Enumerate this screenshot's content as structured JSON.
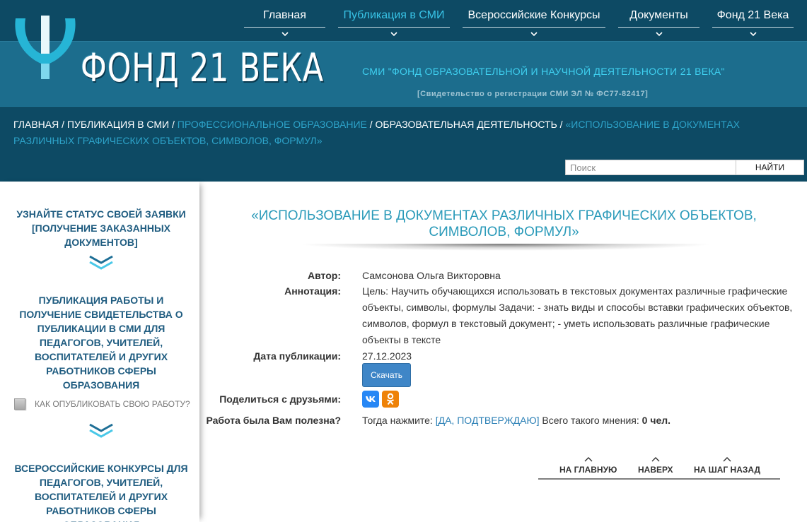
{
  "header": {
    "brand": "ФОНД 21 ВЕКА",
    "media_title": "СМИ \"ФОНД ОБРАЗОВАТЕЛЬНОЙ И НАУЧНОЙ ДЕЯТЕЛЬНОСТИ 21 ВЕКА\"",
    "media_cert": "[Свидетельство о регистрации СМИ ЭЛ № ФС77-82417]"
  },
  "nav": [
    {
      "label": "Главная",
      "active": false
    },
    {
      "label": "Публикация в СМИ",
      "active": true
    },
    {
      "label": "Всероссийские Конкурсы",
      "active": false
    },
    {
      "label": "Документы",
      "active": false
    },
    {
      "label": "Фонд 21 Века",
      "active": false
    }
  ],
  "breadcrumb": {
    "home": "ГЛАВНАЯ",
    "sep": " / ",
    "publication": "ПУБЛИКАЦИЯ В СМИ",
    "prof_edu": "ПРОФЕССИОНАЛЬНОЕ ОБРАЗОВАНИЕ",
    "edu_activity": "ОБРАЗОВАТЕЛЬНАЯ ДЕЯТЕЛЬНОСТЬ",
    "current": "«ИСПОЛЬЗОВАНИЕ В ДОКУМЕНТАХ РАЗЛИЧНЫХ ГРАФИЧЕСКИХ ОБЪЕКТОВ, СИМВОЛОВ, ФОРМУЛ»"
  },
  "search": {
    "placeholder": "Поиск",
    "button": "НАЙТИ"
  },
  "sidebar": {
    "status": "УЗНАЙТЕ СТАТУС СВОЕЙ ЗАЯВКИ [ПОЛУЧЕНИЕ ЗАКАЗАННЫХ ДОКУМЕНТОВ]",
    "publication": "ПУБЛИКАЦИЯ РАБОТЫ И ПОЛУЧЕНИЕ СВИДЕТЕЛЬСТВА О ПУБЛИКАЦИИ В СМИ ДЛЯ ПЕДАГОГОВ, УЧИТЕЛЕЙ, ВОСПИТАТЕЛЕЙ И ДРУГИХ РАБОТНИКОВ СФЕРЫ ОБРАЗОВАНИЯ",
    "howto": "КАК ОПУБЛИКОВАТЬ СВОЮ РАБОТУ?",
    "contests": "ВСЕРОССИЙСКИЕ КОНКУРСЫ ДЛЯ ПЕДАГОГОВ, УЧИТЕЛЕЙ, ВОСПИТАТЕЛЕЙ И ДРУГИХ РАБОТНИКОВ СФЕРЫ ОБРАЗОВАНИЯ"
  },
  "article": {
    "title": "«ИСПОЛЬЗОВАНИЕ В ДОКУМЕНТАХ РАЗЛИЧНЫХ ГРАФИЧЕСКИХ ОБЪЕКТОВ, СИМВОЛОВ, ФОРМУЛ»",
    "author_label": "Автор:",
    "author": "Самсонова Ольга Викторовна",
    "annotation_label": "Аннотация:",
    "annotation": "Цель: Научить обучающихся использовать в текстовых документах различные графические объекты, символы, формулы Задачи: - знать виды и способы вставки графических объектов, символов, формул в текстовый документ; - уметь использовать различные графические объекты в тексте",
    "date_label": "Дата публикации:",
    "date": "27.12.2023",
    "download": "Скачать",
    "share_label": "Поделиться с друзьями:",
    "useful_label": "Работа была Вам полезна?",
    "useful_prefix": "Тогда нажмите: ",
    "useful_confirm": "[ДА, ПОДТВЕРЖДАЮ]",
    "useful_middle": " Всего такого мнения: ",
    "useful_count": "0 чел."
  },
  "bottom_nav": {
    "home": "НА ГЛАВНУЮ",
    "top": "НАВЕРХ",
    "back": "НА ШАГ НАЗАД"
  },
  "colors": {
    "header_dark": "#0d4a64",
    "header_band": "#1c6d8d",
    "accent": "#2a9ab9",
    "sidebar_text": "#1f5c80",
    "button": "#3f86c7"
  }
}
